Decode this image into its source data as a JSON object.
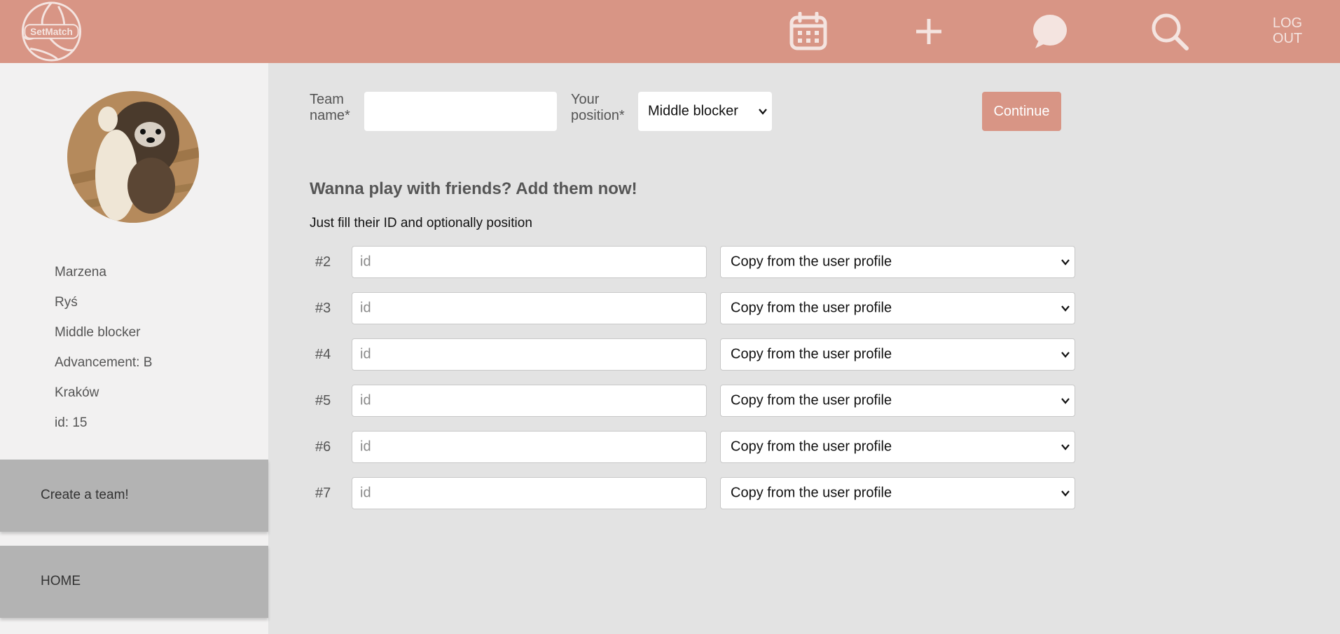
{
  "brand": {
    "logo_text": "SetMatch"
  },
  "nav": {
    "icons": [
      "calendar-icon",
      "plus-icon",
      "chat-icon",
      "search-icon"
    ],
    "logout_line1": "LOG",
    "logout_line2": "OUT"
  },
  "profile": {
    "first_name": "Marzena",
    "last_name": "Ryś",
    "position": "Middle blocker",
    "advancement": "Advancement: B",
    "city": "Kraków",
    "id": "id: 15"
  },
  "sidebar": {
    "create_team": "Create a team!",
    "home": "HOME"
  },
  "form": {
    "team_name_label_1": "Team",
    "team_name_label_2": "name*",
    "team_name_value": "",
    "position_label_1": "Your",
    "position_label_2": "position*",
    "position_selected": "Middle blocker",
    "continue_label": "Continue"
  },
  "friends": {
    "heading": "Wanna play with friends? Add them now!",
    "subtext": "Just fill their ID and optionally position",
    "rows": [
      {
        "num": "#2",
        "id_placeholder": "id",
        "position_selected": "Copy from the user profile"
      },
      {
        "num": "#3",
        "id_placeholder": "id",
        "position_selected": "Copy from the user profile"
      },
      {
        "num": "#4",
        "id_placeholder": "id",
        "position_selected": "Copy from the user profile"
      },
      {
        "num": "#5",
        "id_placeholder": "id",
        "position_selected": "Copy from the user profile"
      },
      {
        "num": "#6",
        "id_placeholder": "id",
        "position_selected": "Copy from the user profile"
      },
      {
        "num": "#7",
        "id_placeholder": "id",
        "position_selected": "Copy from the user profile"
      }
    ]
  },
  "colors": {
    "accent": "#d89585",
    "sidebar_bg": "#f2f1f1",
    "main_bg": "#e3e3e3",
    "sidebar_button": "#b3b3b3"
  }
}
